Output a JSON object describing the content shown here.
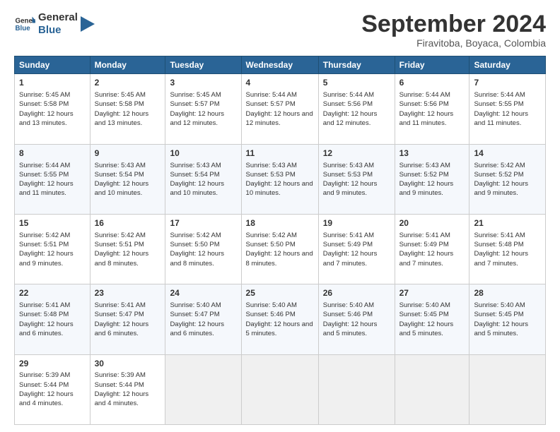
{
  "logo": {
    "line1": "General",
    "line2": "Blue"
  },
  "title": "September 2024",
  "location": "Firavitoba, Boyaca, Colombia",
  "days_of_week": [
    "Sunday",
    "Monday",
    "Tuesday",
    "Wednesday",
    "Thursday",
    "Friday",
    "Saturday"
  ],
  "weeks": [
    [
      {
        "day": "1",
        "sunrise": "5:45 AM",
        "sunset": "5:58 PM",
        "daylight": "12 hours and 13 minutes."
      },
      {
        "day": "2",
        "sunrise": "5:45 AM",
        "sunset": "5:58 PM",
        "daylight": "12 hours and 13 minutes."
      },
      {
        "day": "3",
        "sunrise": "5:45 AM",
        "sunset": "5:57 PM",
        "daylight": "12 hours and 12 minutes."
      },
      {
        "day": "4",
        "sunrise": "5:44 AM",
        "sunset": "5:57 PM",
        "daylight": "12 hours and 12 minutes."
      },
      {
        "day": "5",
        "sunrise": "5:44 AM",
        "sunset": "5:56 PM",
        "daylight": "12 hours and 12 minutes."
      },
      {
        "day": "6",
        "sunrise": "5:44 AM",
        "sunset": "5:56 PM",
        "daylight": "12 hours and 11 minutes."
      },
      {
        "day": "7",
        "sunrise": "5:44 AM",
        "sunset": "5:55 PM",
        "daylight": "12 hours and 11 minutes."
      }
    ],
    [
      {
        "day": "8",
        "sunrise": "5:44 AM",
        "sunset": "5:55 PM",
        "daylight": "12 hours and 11 minutes."
      },
      {
        "day": "9",
        "sunrise": "5:43 AM",
        "sunset": "5:54 PM",
        "daylight": "12 hours and 10 minutes."
      },
      {
        "day": "10",
        "sunrise": "5:43 AM",
        "sunset": "5:54 PM",
        "daylight": "12 hours and 10 minutes."
      },
      {
        "day": "11",
        "sunrise": "5:43 AM",
        "sunset": "5:53 PM",
        "daylight": "12 hours and 10 minutes."
      },
      {
        "day": "12",
        "sunrise": "5:43 AM",
        "sunset": "5:53 PM",
        "daylight": "12 hours and 9 minutes."
      },
      {
        "day": "13",
        "sunrise": "5:43 AM",
        "sunset": "5:52 PM",
        "daylight": "12 hours and 9 minutes."
      },
      {
        "day": "14",
        "sunrise": "5:42 AM",
        "sunset": "5:52 PM",
        "daylight": "12 hours and 9 minutes."
      }
    ],
    [
      {
        "day": "15",
        "sunrise": "5:42 AM",
        "sunset": "5:51 PM",
        "daylight": "12 hours and 9 minutes."
      },
      {
        "day": "16",
        "sunrise": "5:42 AM",
        "sunset": "5:51 PM",
        "daylight": "12 hours and 8 minutes."
      },
      {
        "day": "17",
        "sunrise": "5:42 AM",
        "sunset": "5:50 PM",
        "daylight": "12 hours and 8 minutes."
      },
      {
        "day": "18",
        "sunrise": "5:42 AM",
        "sunset": "5:50 PM",
        "daylight": "12 hours and 8 minutes."
      },
      {
        "day": "19",
        "sunrise": "5:41 AM",
        "sunset": "5:49 PM",
        "daylight": "12 hours and 7 minutes."
      },
      {
        "day": "20",
        "sunrise": "5:41 AM",
        "sunset": "5:49 PM",
        "daylight": "12 hours and 7 minutes."
      },
      {
        "day": "21",
        "sunrise": "5:41 AM",
        "sunset": "5:48 PM",
        "daylight": "12 hours and 7 minutes."
      }
    ],
    [
      {
        "day": "22",
        "sunrise": "5:41 AM",
        "sunset": "5:48 PM",
        "daylight": "12 hours and 6 minutes."
      },
      {
        "day": "23",
        "sunrise": "5:41 AM",
        "sunset": "5:47 PM",
        "daylight": "12 hours and 6 minutes."
      },
      {
        "day": "24",
        "sunrise": "5:40 AM",
        "sunset": "5:47 PM",
        "daylight": "12 hours and 6 minutes."
      },
      {
        "day": "25",
        "sunrise": "5:40 AM",
        "sunset": "5:46 PM",
        "daylight": "12 hours and 5 minutes."
      },
      {
        "day": "26",
        "sunrise": "5:40 AM",
        "sunset": "5:46 PM",
        "daylight": "12 hours and 5 minutes."
      },
      {
        "day": "27",
        "sunrise": "5:40 AM",
        "sunset": "5:45 PM",
        "daylight": "12 hours and 5 minutes."
      },
      {
        "day": "28",
        "sunrise": "5:40 AM",
        "sunset": "5:45 PM",
        "daylight": "12 hours and 5 minutes."
      }
    ],
    [
      {
        "day": "29",
        "sunrise": "5:39 AM",
        "sunset": "5:44 PM",
        "daylight": "12 hours and 4 minutes."
      },
      {
        "day": "30",
        "sunrise": "5:39 AM",
        "sunset": "5:44 PM",
        "daylight": "12 hours and 4 minutes."
      },
      null,
      null,
      null,
      null,
      null
    ]
  ]
}
